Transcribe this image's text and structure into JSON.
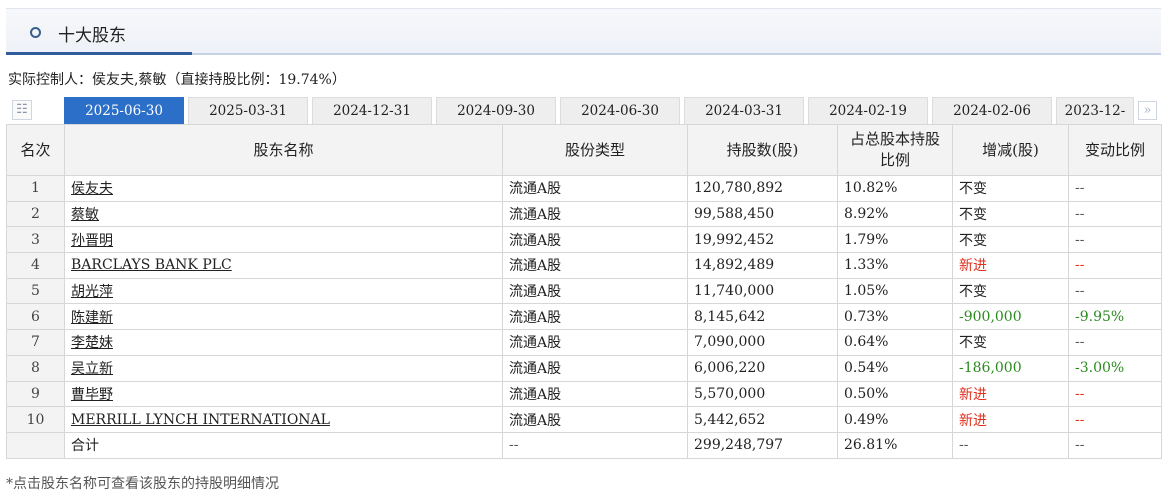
{
  "header": {
    "title": "十大股东",
    "icon": "circle-bullet-icon"
  },
  "controller": "实际控制人：侯友夫,蔡敏（直接持股比例：19.74%）",
  "tabs": [
    "2025-06-30",
    "2025-03-31",
    "2024-12-31",
    "2024-09-30",
    "2024-06-30",
    "2024-03-31",
    "2024-02-19",
    "2024-02-06",
    "2023-12-"
  ],
  "active_tab": "2025-06-30",
  "tab_icons": {
    "list": "list-icon",
    "next": "double-chevron-right-icon"
  },
  "table": {
    "headers": [
      "名次",
      "股东名称",
      "股份类型",
      "持股数(股)",
      "占总股本持股比例",
      "增减(股)",
      "变动比例"
    ],
    "rows": [
      {
        "rank": "1",
        "name": "侯友夫",
        "type": "流通A股",
        "shares": "120,780,892",
        "ratio": "10.82%",
        "change": "不变",
        "change_pct": "--",
        "status": "same"
      },
      {
        "rank": "2",
        "name": "蔡敏",
        "type": "流通A股",
        "shares": "99,588,450",
        "ratio": "8.92%",
        "change": "不变",
        "change_pct": "--",
        "status": "same"
      },
      {
        "rank": "3",
        "name": "孙晋明",
        "type": "流通A股",
        "shares": "19,992,452",
        "ratio": "1.79%",
        "change": "不变",
        "change_pct": "--",
        "status": "same"
      },
      {
        "rank": "4",
        "name": "BARCLAYS BANK PLC",
        "type": "流通A股",
        "shares": "14,892,489",
        "ratio": "1.33%",
        "change": "新进",
        "change_pct": "--",
        "status": "new"
      },
      {
        "rank": "5",
        "name": "胡光萍",
        "type": "流通A股",
        "shares": "11,740,000",
        "ratio": "1.05%",
        "change": "不变",
        "change_pct": "--",
        "status": "same"
      },
      {
        "rank": "6",
        "name": "陈建新",
        "type": "流通A股",
        "shares": "8,145,642",
        "ratio": "0.73%",
        "change": "-900,000",
        "change_pct": "-9.95%",
        "status": "down"
      },
      {
        "rank": "7",
        "name": "李楚妹",
        "type": "流通A股",
        "shares": "7,090,000",
        "ratio": "0.64%",
        "change": "不变",
        "change_pct": "--",
        "status": "same"
      },
      {
        "rank": "8",
        "name": "吴立新",
        "type": "流通A股",
        "shares": "6,006,220",
        "ratio": "0.54%",
        "change": "-186,000",
        "change_pct": "-3.00%",
        "status": "down"
      },
      {
        "rank": "9",
        "name": "曹毕野",
        "type": "流通A股",
        "shares": "5,570,000",
        "ratio": "0.50%",
        "change": "新进",
        "change_pct": "--",
        "status": "new"
      },
      {
        "rank": "10",
        "name": "MERRILL LYNCH INTERNATIONAL",
        "type": "流通A股",
        "shares": "5,442,652",
        "ratio": "0.49%",
        "change": "新进",
        "change_pct": "--",
        "status": "new"
      }
    ],
    "total": {
      "label": "合计",
      "type": "--",
      "shares": "299,248,797",
      "ratio": "26.81%",
      "change": "--",
      "change_pct": "--"
    }
  },
  "footnote": "*点击股东名称可查看该股东的持股明细情况",
  "colors": {
    "active_tab": "#2c6fc8",
    "increase": "#e0301e",
    "decrease": "#2a8b1f",
    "header_accent": "#2f5d9c"
  }
}
